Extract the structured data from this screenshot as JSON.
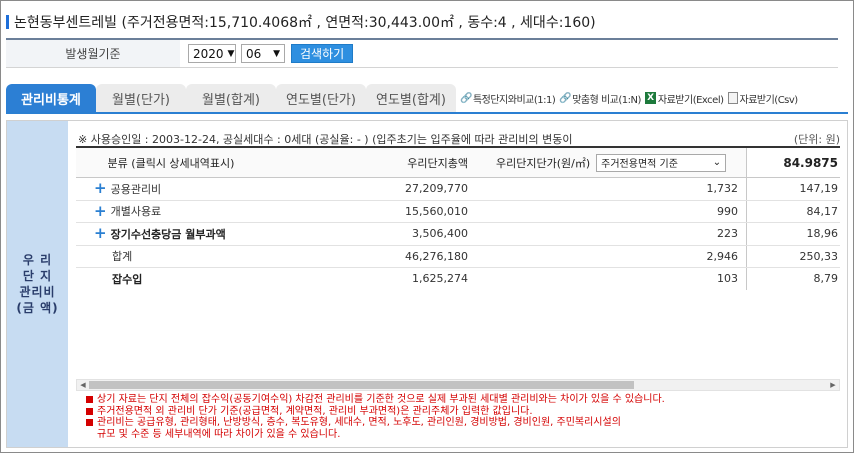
{
  "header": {
    "title": "논현동부센트레빌 (주거전용면적:15,710.4068㎡ , 연면적:30,443.00㎡ , 동수:4 , 세대수:160)"
  },
  "filter": {
    "label": "발생월기준",
    "year": "2020",
    "month": "06",
    "search_label": "검색하기"
  },
  "tabs": [
    {
      "label": "관리비통계",
      "active": true
    },
    {
      "label": "월별(단가)",
      "active": false
    },
    {
      "label": "월별(합계)",
      "active": false
    },
    {
      "label": "연도별(단가)",
      "active": false
    },
    {
      "label": "연도별(합계)",
      "active": false
    }
  ],
  "tab_links": {
    "compare": "특정단지와비교(1:1)",
    "custom": "맞춤형 비교(1:N)",
    "excel": "자료받기(Excel)",
    "csv": "자료받기(Csv)"
  },
  "side_label": "우  리\n단  지\n관리비\n(금 액)",
  "notice": {
    "text": "※ 사용승인일 : 2003-12-24, 공실세대수 : 0세대 (공실율: - ) (입주초기는 입주율에 따라 관리비의 변동이",
    "unit": "(단위: 원)"
  },
  "table": {
    "headers": {
      "category": "분류 (클릭시 상세내역표시)",
      "total": "우리단지총액",
      "unit_price": "우리단지단가(원/㎡)",
      "basis": "주거전용면적 기준",
      "extra": "84.9875"
    },
    "rows": [
      {
        "category": "공용관리비",
        "total": "27,209,770",
        "unit_price": "1,732",
        "extra": "147,19"
      },
      {
        "category": "개별사용료",
        "total": "15,560,010",
        "unit_price": "990",
        "extra": "84,17"
      },
      {
        "category": "장기수선충당금 월부과액",
        "total": "3,506,400",
        "unit_price": "223",
        "extra": "18,96"
      },
      {
        "category": "합계",
        "total": "46,276,180",
        "unit_price": "2,946",
        "extra": "250,33"
      },
      {
        "category": "잡수입",
        "total": "1,625,274",
        "unit_price": "103",
        "extra": "8,79"
      }
    ]
  },
  "notes": [
    "상기 자료는 단지 전체의 잡수익(공동기여수익) 차감전 관리비를 기준한 것으로 실제 부과된 세대별 관리비와는 차이가 있을 수 있습니다.",
    "주거전용면적 외 관리비 단가 기준(공급면적, 계약면적, 관리비 부과면적)은 관리주체가 입력한 값입니다.",
    "관리비는 공급유형, 관리형태, 난방방식, 층수, 복도유형, 세대수, 면적, 노후도, 관리인원, 경비방법, 경비인원, 주민복리시설의",
    "규모 및 수준 등 세부내역에 따라 차이가 있을 수 있습니다."
  ]
}
